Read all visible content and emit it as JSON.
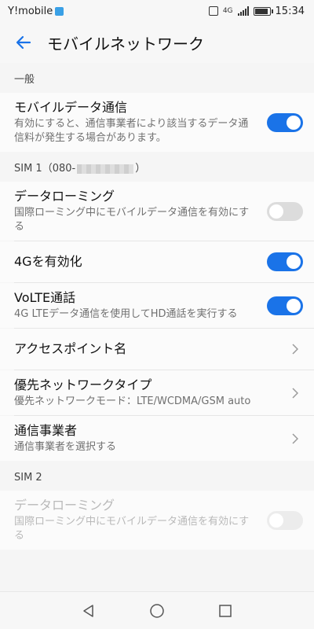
{
  "status_bar": {
    "carrier": "Y!mobile",
    "network": "4G",
    "time": "15:34",
    "icons": [
      "vibrate-icon",
      "signal-icon",
      "battery-icon"
    ]
  },
  "app_bar": {
    "title": "モバイルネットワーク",
    "back_icon": "arrow-left-icon"
  },
  "sections": {
    "general": {
      "header": "一般",
      "mobile_data": {
        "label": "モバイルデータ通信",
        "sub": "有効にすると、通信事業者により該当するデータ通信料が発生する場合があります。",
        "state": "on"
      }
    },
    "sim1": {
      "header": "SIM 1（080-",
      "header_suffix": "）",
      "roaming": {
        "label": "データローミング",
        "sub": "国際ローミング中にモバイルデータ通信を有効にする",
        "state": "off"
      },
      "lte4g": {
        "label": "4Gを有効化",
        "state": "on"
      },
      "volte": {
        "label": "VoLTE通話",
        "sub": "4G LTEデータ通信を使用してHD通話を実行する",
        "state": "on"
      },
      "apn": {
        "label": "アクセスポイント名"
      },
      "network_type": {
        "label": "優先ネットワークタイプ",
        "sub": "優先ネットワークモード：LTE/WCDMA/GSM auto"
      },
      "carrier": {
        "label": "通信事業者",
        "sub": "通信事業者を選択する"
      }
    },
    "sim2": {
      "header": "SIM 2",
      "roaming": {
        "label": "データローミング",
        "sub": "国際ローミング中にモバイルデータ通信を有効にする",
        "state": "disabled"
      }
    }
  },
  "colors": {
    "accent": "#1a73e8",
    "toggle_off": "#dcdcdc",
    "background": "#f5f5f5"
  },
  "nav_bar": {
    "icons": [
      "back-triangle-icon",
      "home-circle-icon",
      "recents-square-icon"
    ]
  }
}
